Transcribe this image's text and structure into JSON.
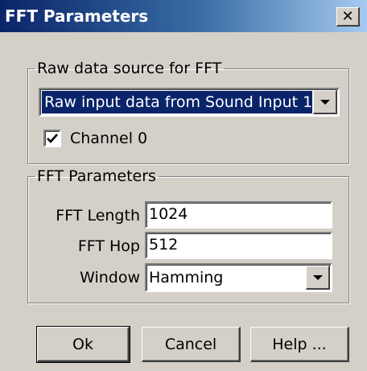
{
  "window": {
    "title": "FFT Parameters",
    "close_glyph": "✕"
  },
  "source_group": {
    "legend": "Raw data source for FFT",
    "selected_source": "Raw input data from Sound Input 1",
    "channel_label": "Channel 0",
    "channel_checked": true
  },
  "params_group": {
    "legend": "FFT Parameters",
    "fft_length_label": "FFT Length",
    "fft_length_value": "1024",
    "fft_hop_label": "FFT Hop",
    "fft_hop_value": "512",
    "window_label": "Window",
    "window_value": "Hamming"
  },
  "buttons": {
    "ok": "Ok",
    "cancel": "Cancel",
    "help": "Help ..."
  },
  "icons": {
    "close": "close-icon",
    "dropdown": "chevron-down-icon",
    "check": "checkmark-icon"
  },
  "colors": {
    "title_gradient_start": "#0a246a",
    "title_gradient_end": "#a6caf0",
    "dialog_face": "#d4d0c8",
    "selection": "#0a246a"
  }
}
